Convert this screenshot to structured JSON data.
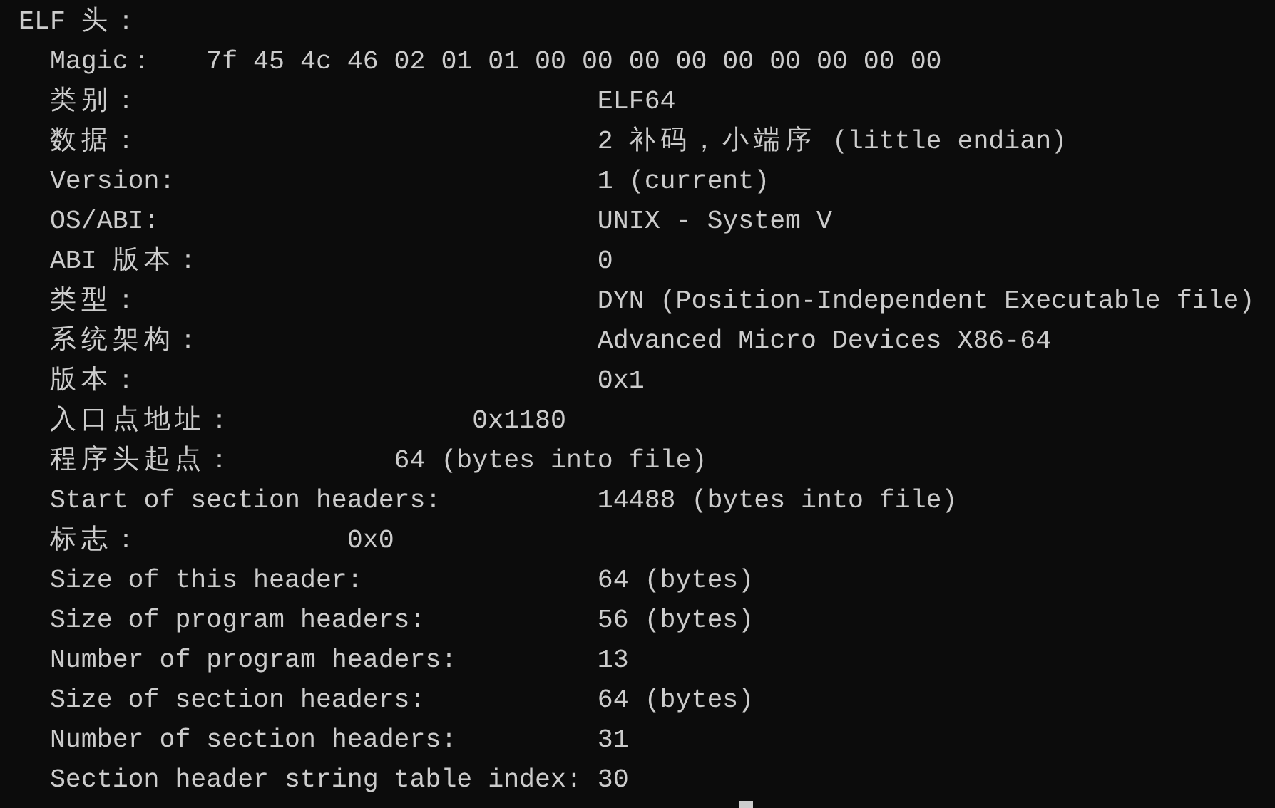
{
  "terminal": {
    "lines": [
      "ELF 头：",
      "  Magic：   7f 45 4c 46 02 01 01 00 00 00 00 00 00 00 00 00",
      "  类别：                             ELF64",
      "  数据：                             2 补码，小端序 (little endian)",
      "  Version:                           1 (current)",
      "  OS/ABI:                            UNIX - System V",
      "  ABI 版本：                         0",
      "  类型：                             DYN (Position-Independent Executable file)",
      "  系统架构：                         Advanced Micro Devices X86-64",
      "  版本：                             0x1",
      "  入口点地址：               0x1180",
      "  程序头起点：          64 (bytes into file)",
      "  Start of section headers:          14488 (bytes into file)",
      "  标志：             0x0",
      "  Size of this header:               64 (bytes)",
      "  Size of program headers:           56 (bytes)",
      "  Number of program headers:         13",
      "  Size of section headers:           64 (bytes)",
      "  Number of section headers:         31",
      "  Section header string table index: 30"
    ]
  }
}
